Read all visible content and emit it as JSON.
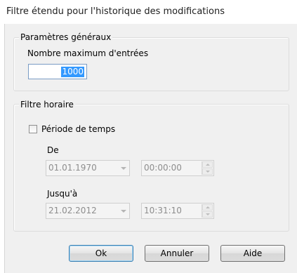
{
  "window": {
    "title": "Filtre étendu pour l'historique des modifications"
  },
  "general": {
    "legend": "Paramètres généraux",
    "max_entries_label": "Nombre maximum d'entrées",
    "max_entries_value": "1000"
  },
  "time_filter": {
    "legend": "Filtre horaire",
    "period_label": "Période de temps",
    "period_checked": false,
    "from_label": "De",
    "from_date": "01.01.1970",
    "from_time": "00:00:00",
    "to_label": "Jusqu'à",
    "to_date": "21.02.2012",
    "to_time": "10:31:10"
  },
  "buttons": {
    "ok": "Ok",
    "cancel": "Annuler",
    "help": "Aide"
  },
  "icons": {
    "combo": "chevron-down-icon",
    "spin_up": "spin-up-icon",
    "spin_down": "spin-down-icon"
  },
  "colors": {
    "selection": "#3399ff",
    "dialog_bg": "#f0f0f0",
    "default_button_border": "#3c7fb1"
  }
}
